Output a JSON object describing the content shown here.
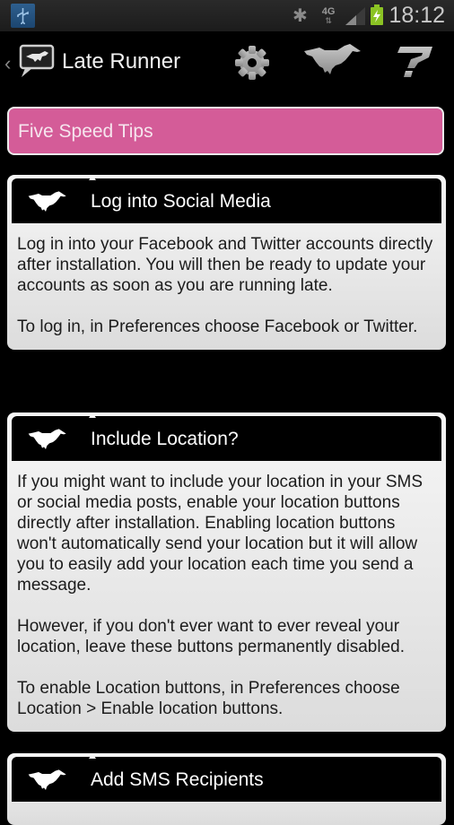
{
  "status_bar": {
    "usb_icon": "usb-icon",
    "bluetooth_icon": "bluetooth-icon",
    "network": "4G",
    "signal_icon": "signal-icon",
    "battery_icon": "battery-charging-icon",
    "time": "18:12"
  },
  "action_bar": {
    "back_glyph": "‹",
    "title": "Late Runner",
    "actions": [
      {
        "name": "settings",
        "icon": "gear-icon"
      },
      {
        "name": "run",
        "icon": "horse-icon"
      },
      {
        "name": "help",
        "icon": "question-icon"
      }
    ]
  },
  "colors": {
    "accent_pink": "#d45c98",
    "battery_green": "#8bc324"
  },
  "banner": {
    "label": "Five Speed Tips"
  },
  "tips": [
    {
      "title": "Log into Social Media",
      "paragraphs": [
        "Log in into your Facebook and Twitter accounts directly after installation. You will then be ready to update your accounts as soon as you are running late.",
        "To log in, in Preferences choose Facebook or Twitter."
      ]
    },
    {
      "title": "Include Location?",
      "paragraphs": [
        "If you might want to include your location in your SMS or social media posts, enable your location buttons directly after installation. Enabling location buttons won't automatically send your location but it will allow you to easily add your location each time you send a message.",
        "However, if you don't ever want to ever reveal your location, leave these buttons permanently disabled.",
        "To enable Location buttons, in Preferences choose Location > Enable location buttons."
      ]
    },
    {
      "title": "Add SMS Recipients",
      "paragraphs": []
    }
  ]
}
